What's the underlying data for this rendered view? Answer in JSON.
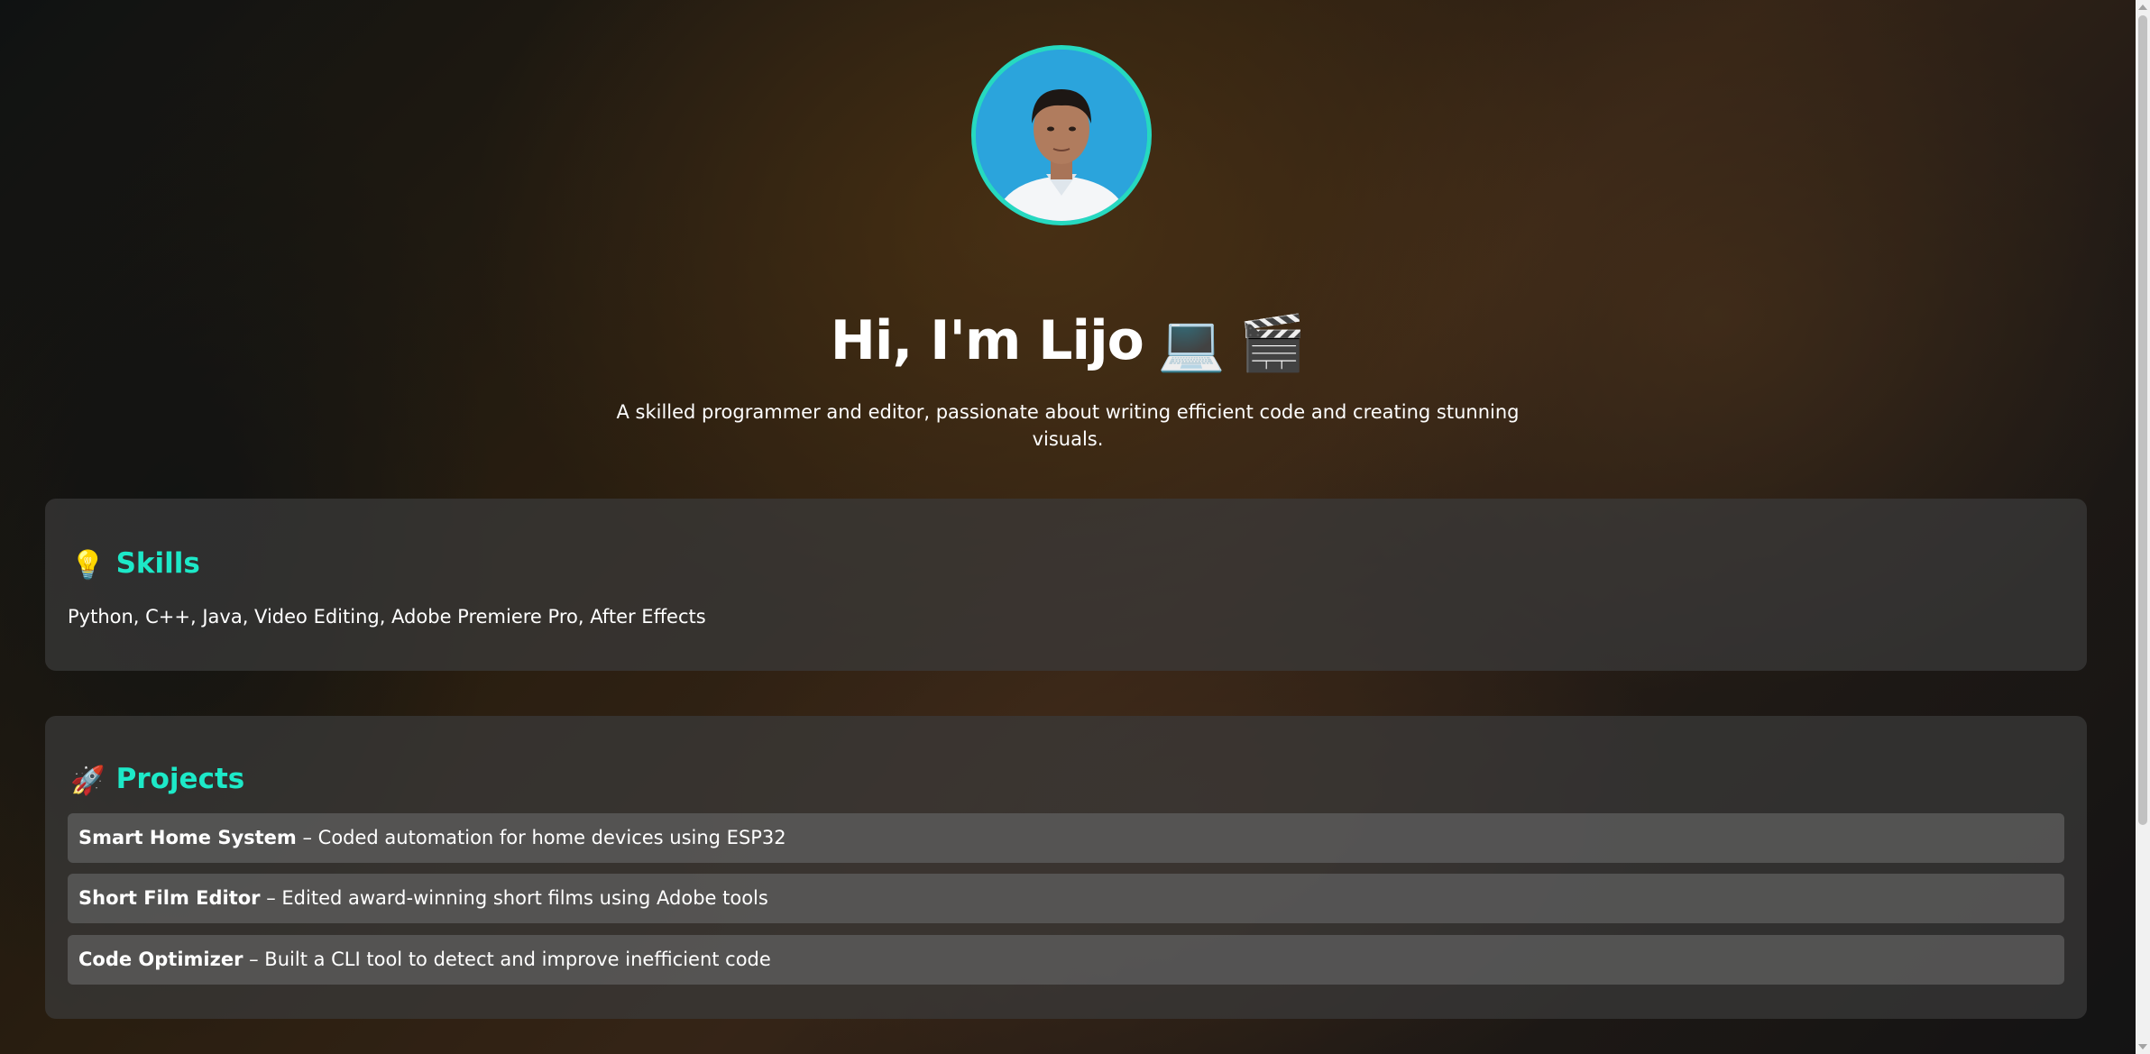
{
  "hero": {
    "name_line": "Hi, I'm Lijo",
    "emoji_laptop": "💻",
    "emoji_clapper": "🎬",
    "tagline": "A skilled programmer and editor, passionate about writing efficient code and creating stunning visuals."
  },
  "skills": {
    "icon": "💡",
    "title": "Skills",
    "text": "Python, C++, Java, Video Editing, Adobe Premiere Pro, After Effects"
  },
  "projects": {
    "icon": "🚀",
    "title": "Projects",
    "items": [
      {
        "name": "Smart Home System",
        "desc": " – Coded automation for home devices using ESP32"
      },
      {
        "name": "Short Film Editor",
        "desc": " – Edited award-winning short films using Adobe tools"
      },
      {
        "name": "Code Optimizer",
        "desc": " – Built a CLI tool to detect and improve inefficient code"
      }
    ]
  },
  "colors": {
    "accent": "#1de9c8",
    "avatar_border": "#26d9c0"
  }
}
